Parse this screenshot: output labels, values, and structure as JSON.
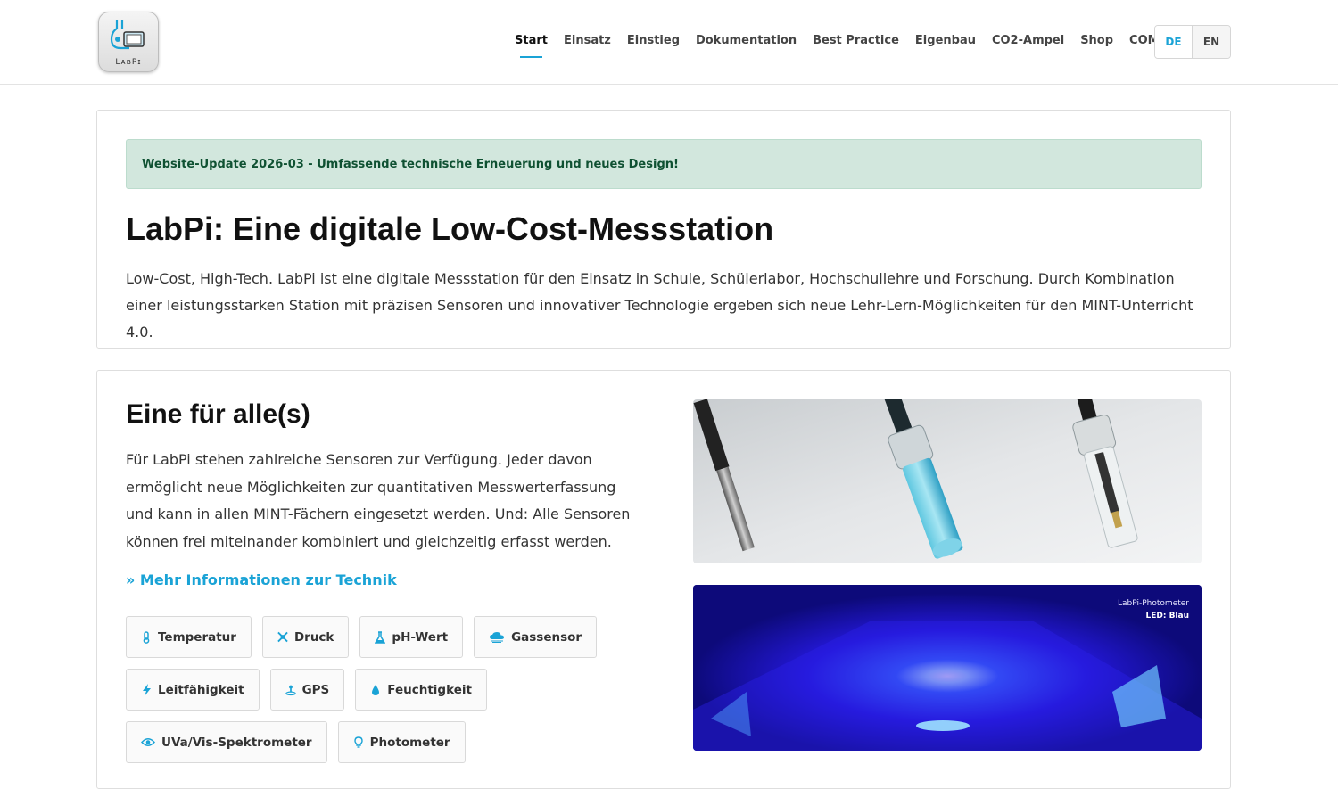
{
  "header": {
    "logo_text": "LᴀʙPɪ",
    "nav": [
      {
        "label": "Start",
        "active": true
      },
      {
        "label": "Einsatz"
      },
      {
        "label": "Einstieg"
      },
      {
        "label": "Dokumentation"
      },
      {
        "label": "Best Practice"
      },
      {
        "label": "Eigenbau"
      },
      {
        "label": "CO2-Ampel"
      },
      {
        "label": "Shop"
      },
      {
        "label": "COMPare"
      }
    ],
    "lang": {
      "de": "DE",
      "en": "EN"
    }
  },
  "intro": {
    "alert": "Website-Update 2026-03 - Umfassende technische Erneuerung und neues Design!",
    "title": "LabPi: Eine digitale Low-Cost-Messstation",
    "lead": "Low-Cost, High-Tech. LabPi ist eine digitale Messstation für den Einsatz in Schule, Schülerlabor, Hochschullehre und Forschung. Durch Kombination einer leistungsstarken Station mit präzisen Sensoren und innovativer Technologie ergeben sich neue Lehr-Lern-Möglichkeiten für den MINT-Unterricht 4.0."
  },
  "features": {
    "title": "Eine für alle(s)",
    "body": "Für LabPi stehen zahlreiche Sensoren zur Verfügung. Jeder davon ermöglicht neue Möglichkeiten zur quantitativen Messwerterfassung und kann in allen MINT-Fächern eingesetzt werden. Und: Alle Sensoren können frei miteinander kombiniert und gleichzeitig erfasst werden.",
    "more_link": "» Mehr Informationen zur Technik",
    "tags": [
      {
        "label": "Temperatur",
        "icon": "thermometer-icon"
      },
      {
        "label": "Druck",
        "icon": "compress-icon"
      },
      {
        "label": "pH-Wert",
        "icon": "flask-icon"
      },
      {
        "label": "Gassensor",
        "icon": "cloud-icon"
      },
      {
        "label": "Leitfähigkeit",
        "icon": "bolt-icon"
      },
      {
        "label": "GPS",
        "icon": "location-icon"
      },
      {
        "label": "Feuchtigkeit",
        "icon": "droplet-icon"
      },
      {
        "label": "UVa/Vis-Spektrometer",
        "icon": "eye-icon"
      },
      {
        "label": "Photometer",
        "icon": "lightbulb-icon"
      }
    ],
    "image2_caption": {
      "line1": "LabPi-Photometer",
      "line2": "LED: Blau"
    }
  },
  "colors": {
    "accent": "#1aa3d6",
    "alert_bg": "#d2e7dd",
    "alert_text": "#0f5132"
  }
}
